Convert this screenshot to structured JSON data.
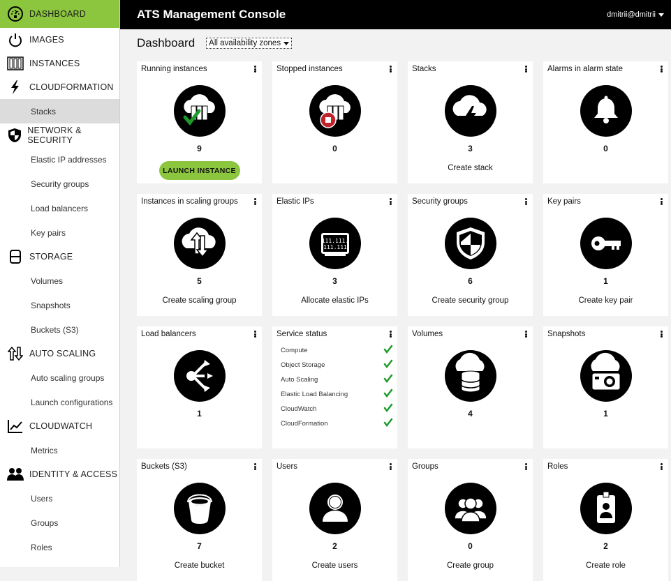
{
  "app": {
    "title": "ATS Management Console",
    "user": "dmitrii@dmitrii"
  },
  "sidebar": {
    "items": [
      {
        "type": "section",
        "label": "DASHBOARD",
        "icon": "speedometer-icon",
        "active": true
      },
      {
        "type": "section",
        "label": "IMAGES",
        "icon": "power-icon"
      },
      {
        "type": "section",
        "label": "INSTANCES",
        "icon": "server-rack-icon"
      },
      {
        "type": "section",
        "label": "CLOUDFORMATION",
        "icon": "lightning-icon"
      },
      {
        "type": "sub",
        "label": "Stacks",
        "active": true
      },
      {
        "type": "section",
        "label": "NETWORK & SECURITY",
        "icon": "shield-icon"
      },
      {
        "type": "sub",
        "label": "Elastic IP addresses"
      },
      {
        "type": "sub",
        "label": "Security groups"
      },
      {
        "type": "sub",
        "label": "Load balancers"
      },
      {
        "type": "sub",
        "label": "Key pairs"
      },
      {
        "type": "section",
        "label": "STORAGE",
        "icon": "storage-icon"
      },
      {
        "type": "sub",
        "label": "Volumes"
      },
      {
        "type": "sub",
        "label": "Snapshots"
      },
      {
        "type": "sub",
        "label": "Buckets (S3)"
      },
      {
        "type": "section",
        "label": "AUTO SCALING",
        "icon": "scaling-icon"
      },
      {
        "type": "sub",
        "label": "Auto scaling groups"
      },
      {
        "type": "sub",
        "label": "Launch configurations"
      },
      {
        "type": "section",
        "label": "CLOUDWATCH",
        "icon": "chart-icon"
      },
      {
        "type": "sub",
        "label": "Metrics"
      },
      {
        "type": "section",
        "label": "IDENTITY & ACCESS",
        "icon": "users-icon"
      },
      {
        "type": "sub",
        "label": "Users"
      },
      {
        "type": "sub",
        "label": "Groups"
      },
      {
        "type": "sub",
        "label": "Roles"
      }
    ]
  },
  "page": {
    "title": "Dashboard",
    "zone_select": "All availability zones"
  },
  "tiles": [
    {
      "name": "Running instances",
      "icon": "running-instances-icon",
      "count": "9",
      "button": "LAUNCH INSTANCE"
    },
    {
      "name": "Stopped instances",
      "icon": "stopped-instances-icon",
      "count": "0"
    },
    {
      "name": "Stacks",
      "icon": "stack-cloud-icon",
      "count": "3",
      "action": "Create stack"
    },
    {
      "name": "Alarms in alarm state",
      "icon": "bell-icon",
      "count": "0"
    },
    {
      "name": "Instances in scaling groups",
      "icon": "scaling-cloud-icon",
      "count": "5",
      "action": "Create scaling group"
    },
    {
      "name": "Elastic IPs",
      "icon": "elastic-ip-icon",
      "count": "3",
      "action": "Allocate elastic IPs"
    },
    {
      "name": "Security groups",
      "icon": "security-shield-icon",
      "count": "6",
      "action": "Create security group"
    },
    {
      "name": "Key pairs",
      "icon": "key-icon",
      "count": "1",
      "action": "Create key pair"
    },
    {
      "name": "Load balancers",
      "icon": "load-balancer-icon",
      "count": "1"
    },
    {
      "name": "Service status",
      "status": [
        {
          "label": "Compute"
        },
        {
          "label": "Object Storage"
        },
        {
          "label": "Auto Scaling"
        },
        {
          "label": "Elastic Load Balancing"
        },
        {
          "label": "CloudWatch"
        },
        {
          "label": "CloudFormation"
        }
      ]
    },
    {
      "name": "Volumes",
      "icon": "volume-database-icon",
      "count": "4"
    },
    {
      "name": "Snapshots",
      "icon": "camera-icon",
      "count": "1"
    },
    {
      "name": "Buckets (S3)",
      "icon": "bucket-icon",
      "count": "7",
      "action": "Create bucket"
    },
    {
      "name": "Users",
      "icon": "user-icon",
      "count": "2",
      "action": "Create users"
    },
    {
      "name": "Groups",
      "icon": "group-icon",
      "count": "0",
      "action": "Create group"
    },
    {
      "name": "Roles",
      "icon": "role-badge-icon",
      "count": "2",
      "action": "Create role"
    }
  ],
  "colors": {
    "accent": "#8cc63f",
    "topbar": "#000000",
    "check": "#1e9a2b",
    "stop": "#c0232b"
  }
}
